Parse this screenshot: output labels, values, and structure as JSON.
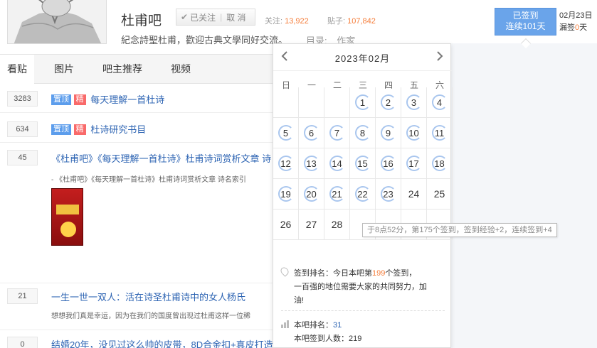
{
  "header": {
    "forum_name": "杜甫吧",
    "follow": {
      "followed_label": "已关注",
      "cancel_label": "取 消"
    },
    "stats": {
      "follow_label": "关注:",
      "follow_count": "13,922",
      "post_label": "贴子:",
      "post_count": "107,842"
    },
    "slogan": "紀念詩聖杜甫，歡迎古典文學同好交流。",
    "directory_label": "目录:",
    "directory_value": "作家"
  },
  "sign": {
    "status": "已签到",
    "streak": "连续101天",
    "date": "02月23日",
    "missed_prefix": "漏签",
    "missed_count": "0",
    "missed_suffix": "天"
  },
  "tabs": [
    {
      "label": "看贴",
      "active": true
    },
    {
      "label": "图片"
    },
    {
      "label": "吧主推荐"
    },
    {
      "label": "视频"
    }
  ],
  "posts": [
    {
      "replies": "3283",
      "tags": [
        "置顶",
        "精"
      ],
      "title": "每天理解一首杜诗"
    },
    {
      "replies": "634",
      "tags": [
        "置顶",
        "精"
      ],
      "title": "杜诗研究书目"
    },
    {
      "replies": "45",
      "title": "《杜甫吧》《每天理解一首杜诗》杜甫诗词赏析文章 诗",
      "abstract": "- 《杜甫吧》《每天理解一首杜诗》杜甫诗词赏析文章 诗名索引"
    },
    {
      "replies": "21",
      "title": "一生一世一双人：活在诗圣杜甫诗中的女人杨氏",
      "abstract": "想想我们真是幸运，因为在我们的国度曾出现过杜甫这样一位稀"
    },
    {
      "replies": "0",
      "title": "结婚20年，没见过这么帅的皮带，8D合金扣+真皮打造"
    }
  ],
  "calendar": {
    "month": "2023年02月",
    "prev_icon": "chevron-left-icon",
    "next_icon": "chevron-right-icon",
    "weekdays": [
      "日",
      "一",
      "二",
      "三",
      "四",
      "五",
      "六"
    ],
    "first_weekday": 3,
    "days_in_month": 28,
    "signed_through": 23,
    "tooltip": "于8点52分，第175个签到，签到经验+2，连续签到+4",
    "rank_line1_prefix": "签到排名：今日本吧第",
    "rank_number": "199",
    "rank_line1_suffix": "个签到，",
    "rank_line2": "一百强的地位需要大家的共同努力，加",
    "rank_line3": "油!",
    "forum_rank_label": "本吧排名：",
    "forum_rank": "31",
    "forum_sign_label": "本吧签到人数：",
    "forum_sign_count": "219"
  }
}
